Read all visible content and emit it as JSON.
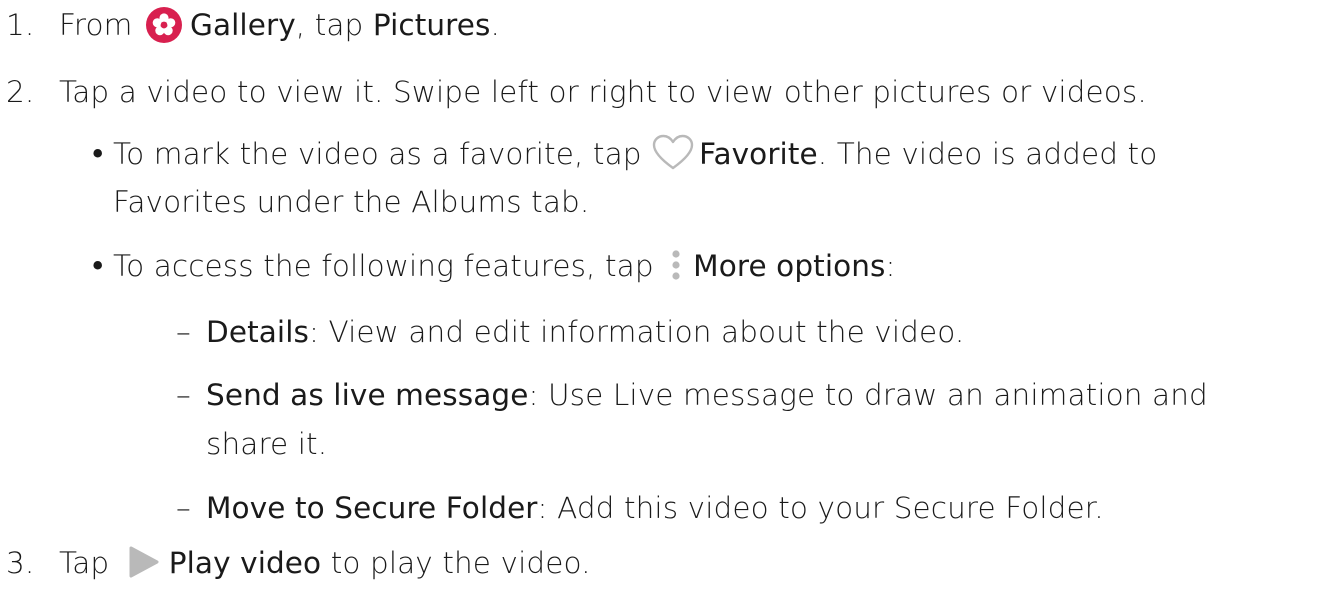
{
  "steps": [
    {
      "num": "1.",
      "pre": "From",
      "gallery": "Gallery",
      "mid": ", tap ",
      "pictures": "Pictures",
      "post": "."
    },
    {
      "num": "2.",
      "text": "Tap a video to view it. Swipe left or right to view other pictures or videos."
    },
    {
      "num": "3.",
      "pre": "Tap",
      "play": "Play video",
      "post": " to play the video."
    }
  ],
  "bullets": {
    "favorite": {
      "pre": "To mark the video as a favorite, tap",
      "label": "Favorite",
      "post": ". The video is added to",
      "cont": "Favorites under the Albums tab."
    },
    "more": {
      "pre": "To access the following features, tap",
      "label": "More options",
      "post": ":"
    }
  },
  "sub_items": [
    {
      "label": "Details",
      "text": ": View and edit information about the video."
    },
    {
      "label": "Send as live message",
      "text": ": Use Live message to draw an animation and",
      "cont": "share it."
    },
    {
      "label": "Move to Secure Folder",
      "text": ": Add this video to your Secure Folder."
    }
  ],
  "colors": {
    "text": "#1a1a1a",
    "gallery_icon": "#d8204f",
    "icon_gray": "#b9b9b9"
  },
  "icons": [
    "gallery-icon",
    "heart-icon",
    "more-options-icon",
    "play-icon"
  ]
}
